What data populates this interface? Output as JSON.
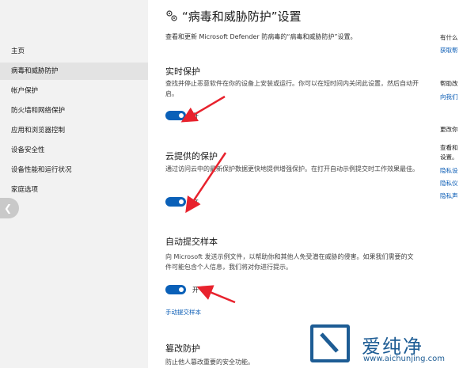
{
  "sidebar": {
    "items": [
      {
        "label": "主页"
      },
      {
        "label": "病毒和威胁防护",
        "selected": true
      },
      {
        "label": "帐户保护"
      },
      {
        "label": "防火墙和网络保护"
      },
      {
        "label": "应用和浏览器控制"
      },
      {
        "label": "设备安全性"
      },
      {
        "label": "设备性能和运行状况"
      },
      {
        "label": "家庭选项"
      }
    ]
  },
  "header": {
    "title": "“病毒和威胁防护”设置",
    "description": "查看和更新 Microsoft Defender 防病毒的“病毒和威胁防护”设置。"
  },
  "sections": {
    "realtime": {
      "title": "实时保护",
      "desc": "查找并停止恶意软件在你的设备上安装或运行。你可以在短时间内关闭此设置，然后自动开启。",
      "toggle_label": "开"
    },
    "cloud": {
      "title": "云提供的保护",
      "desc": "通过访问云中的最新保护数据更快地提供增强保护。在打开自动示例提交时工作效果最佳。",
      "toggle_label": "开"
    },
    "sample": {
      "title": "自动提交样本",
      "desc": "向 Microsoft 发送示例文件，以帮助你和其他人免受潜在威胁的侵害。如果我们需要的文件可能包含个人信息，我们将对你进行提示。",
      "toggle_label": "开",
      "link": "手动提交样本"
    },
    "tamper": {
      "title": "篡改防护",
      "desc": "防止他人篡改重要的安全功能。"
    }
  },
  "right_column": {
    "q1": "有什么",
    "l1": "获取帮",
    "q2": "帮助改",
    "l2": "向我们",
    "q3": "更改你",
    "t3a": "查看和",
    "t3b": "设置。",
    "l3a": "隐私设",
    "l3b": "隐私仪",
    "l3c": "隐私声"
  },
  "watermark": {
    "text": "爱纯净",
    "url": "www.aichunjing.com"
  },
  "colors": {
    "toggle_on": "#0a60b8",
    "link": "#0a5cb5",
    "sidebar_bg": "#f2f2f2",
    "arrow": "#e8222d"
  }
}
